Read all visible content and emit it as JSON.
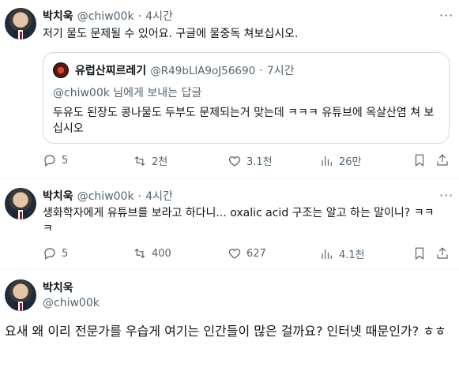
{
  "tweets": [
    {
      "name": "박치욱",
      "handle": "@chiw00k",
      "time": "4시간",
      "text": "저기 물도 문제될 수 있어요. 구글에 물중독 쳐보십시오.",
      "quote": {
        "name": "유럽산찌르레기",
        "handle": "@R49bLlA9oJ56690",
        "time": "7시간",
        "reply_to": "@chiw00k 님에게 보내는 답글",
        "text": "두유도 된장도 콩나물도 두부도 문제되는거 맞는데 ㅋㅋㅋ 유튜브에 옥살산염 쳐 보십시오"
      },
      "stats": {
        "replies": "5",
        "retweets": "2천",
        "likes": "3.1천",
        "views": "26만"
      }
    },
    {
      "name": "박치욱",
      "handle": "@chiw00k",
      "time": "4시간",
      "text": "생화학자에게 유튜브를 보라고 하다니... oxalic acid 구조는 알고 하는 말이니? ㅋㅋㅋ",
      "stats": {
        "replies": "5",
        "retweets": "400",
        "likes": "627",
        "views": "4.1천"
      }
    },
    {
      "name": "박치욱",
      "handle": "@chiw00k",
      "text": "요새 왜 이리 전문가를 우습게 여기는 인간들이 많은 걸까요? 인터넷 때문인가? ㅎㅎ"
    }
  ],
  "separator": "·",
  "icons": [
    "reply-icon",
    "retweet-icon",
    "like-icon",
    "views-icon",
    "bookmark-icon",
    "share-icon"
  ]
}
